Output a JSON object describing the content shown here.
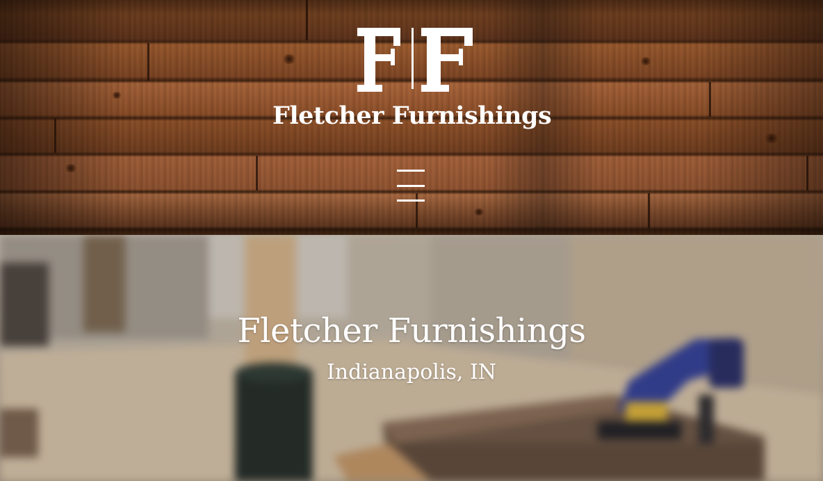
{
  "header": {
    "logo_monogram": "FF",
    "brand_name": "Fletcher Furnishings",
    "menu_icon": "hamburger-menu-icon"
  },
  "hero": {
    "title": "Fletcher Furnishings",
    "subtitle": "Indianapolis, IN"
  },
  "colors": {
    "text": "#ffffff",
    "wood": "#8a4e26",
    "hero_bg": "#bdb3a4",
    "clamp_blue": "#2f3f9e"
  }
}
